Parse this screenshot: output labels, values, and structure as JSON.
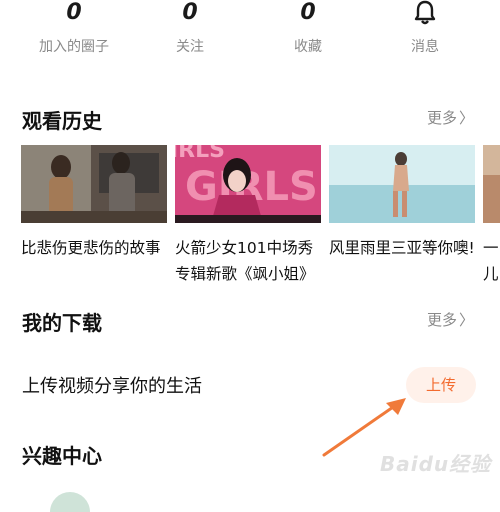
{
  "stats": [
    {
      "value": "0",
      "label": "加入的圈子"
    },
    {
      "value": "0",
      "label": "关注"
    },
    {
      "value": "0",
      "label": "收藏"
    },
    {
      "icon": "bell-icon",
      "label": "消息"
    }
  ],
  "history": {
    "title": "观看历史",
    "more": "更多",
    "items": [
      {
        "caption": "比悲伤更悲伤的故事"
      },
      {
        "caption": "火箭少女101中场秀专辑新歌《飒小姐》"
      },
      {
        "caption": "风里雨里三亚等你噢!"
      },
      {
        "caption": "一儿"
      }
    ]
  },
  "downloads": {
    "title": "我的下载",
    "more": "更多"
  },
  "upload": {
    "prompt": "上传视频分享你的生活",
    "button": "上传"
  },
  "interest": {
    "title": "兴趣中心"
  },
  "watermark": "Baidu经验",
  "colors": {
    "accent": "#f36b2f",
    "upload_button_bg": "#fff1ea",
    "arrow": "#f07a3a"
  }
}
